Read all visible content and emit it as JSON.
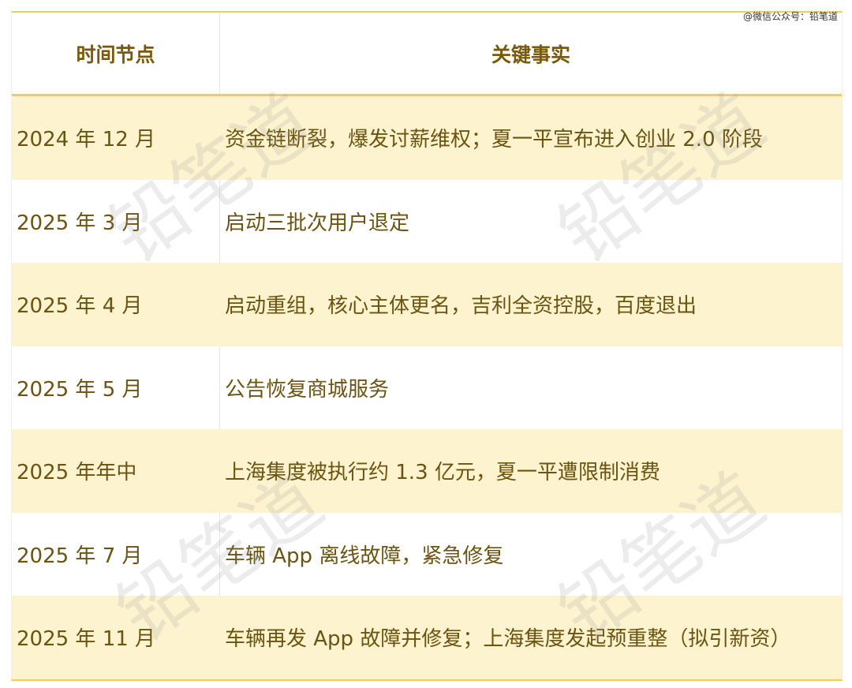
{
  "credit": "@微信公众号：铅笔道",
  "table": {
    "headers": [
      "时间节点",
      "关键事实"
    ],
    "rows": [
      {
        "time": "2024 年 12 月",
        "fact": "资金链断裂，爆发讨薪维权；夏一平宣布进入创业 2.0 阶段"
      },
      {
        "time": "2025 年 3 月",
        "fact": "启动三批次用户退定"
      },
      {
        "time": "2025 年 4 月",
        "fact": "启动重组，核心主体更名，吉利全资控股，百度退出"
      },
      {
        "time": "2025 年 5 月",
        "fact": "公告恢复商城服务"
      },
      {
        "time": "2025 年年中",
        "fact": "上海集度被执行约 1.3 亿元，夏一平遭限制消费"
      },
      {
        "time": "2025 年 7 月",
        "fact": "车辆 App 离线故障，紧急修复"
      },
      {
        "time": "2025 年 11 月",
        "fact": "车辆再发 App 故障并修复；上海集度发起预重整（拟引新资）"
      }
    ]
  },
  "watermark": "铅笔道",
  "colors": {
    "accent": "#f2cd4e",
    "row_highlight": "#fdf3cf",
    "text": "#6b5410",
    "header_text": "#7a5a08"
  }
}
